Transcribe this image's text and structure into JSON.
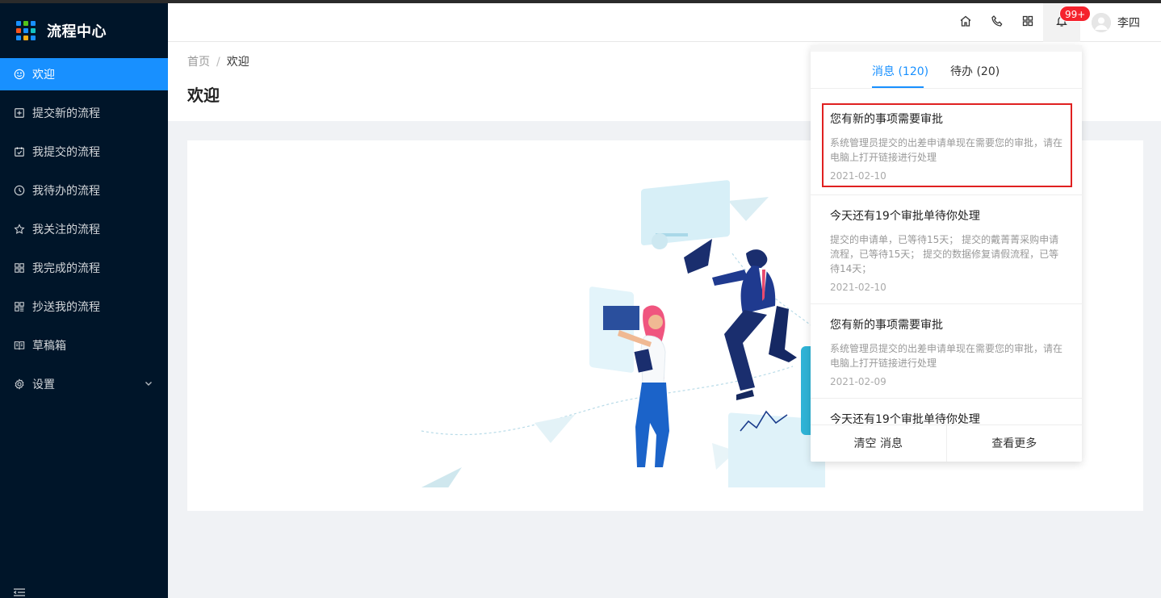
{
  "app": {
    "title": "流程中心"
  },
  "sidebar": {
    "items": [
      {
        "label": "欢迎",
        "icon": "smile-icon",
        "active": true
      },
      {
        "label": "提交新的流程",
        "icon": "plus-square-icon"
      },
      {
        "label": "我提交的流程",
        "icon": "check-square-icon"
      },
      {
        "label": "我待办的流程",
        "icon": "clock-icon"
      },
      {
        "label": "我关注的流程",
        "icon": "star-icon"
      },
      {
        "label": "我完成的流程",
        "icon": "appstore-icon"
      },
      {
        "label": "抄送我的流程",
        "icon": "copy-grid-icon"
      },
      {
        "label": "草稿箱",
        "icon": "book-icon"
      },
      {
        "label": "设置",
        "icon": "gear-icon",
        "has_children": true
      }
    ]
  },
  "header": {
    "badge": "99+",
    "username": "李四",
    "icons": [
      "home-icon",
      "phone-icon",
      "apps-icon",
      "bell-icon"
    ]
  },
  "breadcrumb": {
    "home": "首页",
    "separator": "/",
    "current": "欢迎"
  },
  "page": {
    "title": "欢迎"
  },
  "notifications": {
    "tabs": [
      {
        "label": "消息 (120)",
        "active": true
      },
      {
        "label": "待办 (20)"
      }
    ],
    "items": [
      {
        "title": "您有新的事项需要审批",
        "desc": "系统管理员提交的出差申请单现在需要您的审批，请在电脑上打开链接进行处理",
        "date": "2021-02-10"
      },
      {
        "title": "今天还有19个审批单待你处理",
        "desc": "提交的申请单，已等待15天； 提交的戴菁菁采购申请流程，已等待15天； 提交的数据修复请假流程，已等待14天；",
        "date": "2021-02-10"
      },
      {
        "title": "您有新的事项需要审批",
        "desc": "系统管理员提交的出差申请单现在需要您的审批，请在电脑上打开链接进行处理",
        "date": "2021-02-09"
      },
      {
        "title": "今天还有19个审批单待你处理",
        "desc": "",
        "date": ""
      }
    ],
    "footer": {
      "clear": "清空 消息",
      "more": "查看更多"
    }
  },
  "colors": {
    "primary": "#1890ff",
    "sidebar_bg": "#001529",
    "badge": "#f5222d",
    "highlight_border": "#e02020"
  }
}
